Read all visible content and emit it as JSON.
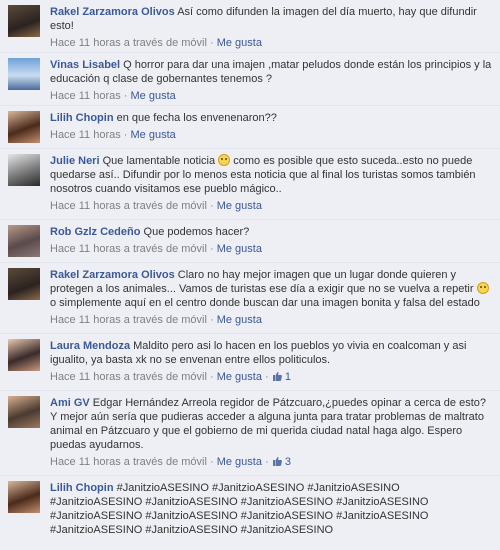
{
  "comments": [
    {
      "author": "Rakel Zarzamora Olivos",
      "text": "Así como difunden la imagen del día muerto, hay que difundir esto!",
      "time": "Hace 11 horas a través de móvil",
      "like": "Me gusta",
      "likes": ""
    },
    {
      "author": "Vinas Lisabel",
      "text": "Q horror para dar una imajen ,matar peludos donde están los principios y la educación q clase de gobernantes tenemos ?",
      "time": "Hace 11 horas",
      "like": "Me gusta",
      "likes": ""
    },
    {
      "author": "Lilih Chopin",
      "text": "en que fecha los envenenaron??",
      "time": "Hace 11 horas",
      "like": "Me gusta",
      "likes": ""
    },
    {
      "author": "Julie Neri",
      "text_a": "Que lamentable noticia",
      "text_b": "como es posible que esto suceda..esto no puede quedarse así.. Difundir por lo menos esta noticia que al final los turistas somos también nosotros cuando visitamos ese pueblo mágico..",
      "time": "Hace 11 horas a través de móvil",
      "like": "Me gusta",
      "likes": ""
    },
    {
      "author": "Rob Gzlz Cedeño",
      "text": "Que podemos hacer?",
      "time": "Hace 11 horas a través de móvil",
      "like": "Me gusta",
      "likes": ""
    },
    {
      "author": "Rakel Zarzamora Olivos",
      "text_a": "Claro no hay mejor imagen que un lugar donde quieren y protegen a los animales... Vamos de turistas ese día a exigir que no se vuelva a repetir",
      "text_b": "o simplemente aquí en el centro donde buscan dar una imagen bonita y falsa del estado",
      "time": "Hace 11 horas a través de móvil",
      "like": "Me gusta",
      "likes": ""
    },
    {
      "author": "Laura Mendoza",
      "text": "Maldito pero asi lo hacen en los pueblos yo vivia en coalcoman y asi igualito, ya basta xk no se envenan entre ellos politiculos.",
      "time": "Hace 11 horas a través de móvil",
      "like": "Me gusta",
      "likes": "1"
    },
    {
      "author": "Ami GV",
      "text": "Edgar Hernández Arreola regidor de Pátzcuaro,¿puedes opinar a cerca de esto? Y mejor aún sería que pudieras acceder a alguna junta para tratar problemas de maltrato animal en Pátzcuaro y que el gobierno de mi querida ciudad natal haga algo. Espero puedas ayudarnos.",
      "time": "Hace 11 horas a través de móvil",
      "like": "Me gusta",
      "likes": "3"
    },
    {
      "author": "Lilih Chopin",
      "text": "#JanitzioASESINO #JanitzioASESINO #JanitzioASESINO #JanitzioASESINO #JanitzioASESINO #JanitzioASESINO #JanitzioASESINO #JanitzioASESINO #JanitzioASESINO #JanitzioASESINO #JanitzioASESINO #JanitzioASESINO #JanitzioASESINO #JanitzioASESINO",
      "time": "",
      "like": "",
      "likes": ""
    }
  ],
  "icons": {
    "smiley": "frown-emoticon",
    "like": "thumbs-up-icon"
  },
  "colors": {
    "link": "#3b5998",
    "meta": "#808080",
    "bg": "#edeff4"
  }
}
